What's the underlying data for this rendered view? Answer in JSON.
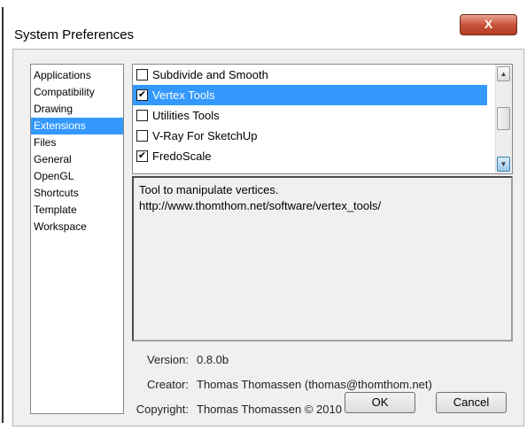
{
  "window": {
    "title": "System Preferences",
    "close_label": "X"
  },
  "categories": [
    {
      "label": "Applications",
      "selected": false
    },
    {
      "label": "Compatibility",
      "selected": false
    },
    {
      "label": "Drawing",
      "selected": false
    },
    {
      "label": "Extensions",
      "selected": true
    },
    {
      "label": "Files",
      "selected": false
    },
    {
      "label": "General",
      "selected": false
    },
    {
      "label": "OpenGL",
      "selected": false
    },
    {
      "label": "Shortcuts",
      "selected": false
    },
    {
      "label": "Template",
      "selected": false
    },
    {
      "label": "Workspace",
      "selected": false
    }
  ],
  "extensions": [
    {
      "label": "Subdivide and Smooth",
      "checked": false,
      "selected": false
    },
    {
      "label": "Vertex Tools",
      "checked": true,
      "selected": true
    },
    {
      "label": "Utilities Tools",
      "checked": false,
      "selected": false
    },
    {
      "label": "V-Ray For SketchUp",
      "checked": false,
      "selected": false
    },
    {
      "label": "FredoScale",
      "checked": true,
      "selected": false
    }
  ],
  "description": {
    "line1": "Tool to manipulate vertices.",
    "line2": "http://www.thomthom.net/software/vertex_tools/"
  },
  "details": {
    "version_label": "Version:",
    "version_value": "0.8.0b",
    "creator_label": "Creator:",
    "creator_value": "Thomas Thomassen (thomas@thomthom.net)",
    "copyright_label": "Copyright:",
    "copyright_value": "Thomas Thomassen © 2010"
  },
  "buttons": {
    "ok": "OK",
    "cancel": "Cancel"
  },
  "colors": {
    "selection": "#3399ff",
    "close_button": "#c9533a"
  }
}
